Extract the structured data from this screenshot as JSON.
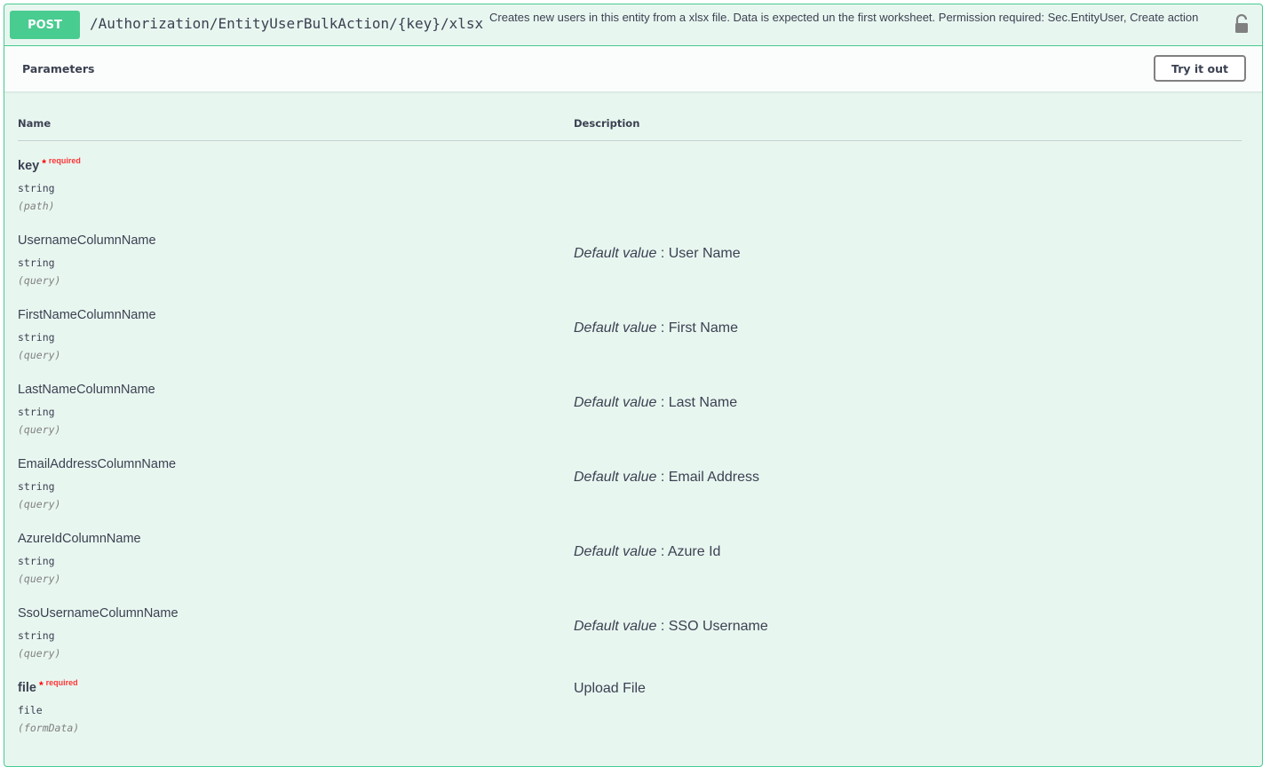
{
  "operation": {
    "method": "POST",
    "path": "/Authorization/EntityUserBulkAction/{key}/xlsx",
    "summary": "Creates new users in this entity from a xlsx file. Data is expected un the first worksheet. Permission required: Sec.EntityUser, Create action",
    "lock_icon": "unlocked-padlock-icon",
    "accent_color": "#49cc90",
    "background_color": "#e8f6f0"
  },
  "parameters_section": {
    "title": "Parameters",
    "try_button": "Try it out",
    "columns": {
      "name": "Name",
      "description": "Description"
    }
  },
  "labels": {
    "required": "required",
    "star": "*",
    "default_value": "Default value",
    "colon": " : "
  },
  "params": [
    {
      "name": "key",
      "type": "string",
      "in": "(path)",
      "default": ""
    },
    {
      "name": "UsernameColumnName",
      "type": "string",
      "in": "(query)",
      "default": "User Name"
    },
    {
      "name": "FirstNameColumnName",
      "type": "string",
      "in": "(query)",
      "default": "First Name"
    },
    {
      "name": "LastNameColumnName",
      "type": "string",
      "in": "(query)",
      "default": "Last Name"
    },
    {
      "name": "EmailAddressColumnName",
      "type": "string",
      "in": "(query)",
      "default": "Email Address"
    },
    {
      "name": "AzureIdColumnName",
      "type": "string",
      "in": "(query)",
      "default": "Azure Id"
    },
    {
      "name": "SsoUsernameColumnName",
      "type": "string",
      "in": "(query)",
      "default": "SSO Username"
    },
    {
      "name": "file",
      "type": "file",
      "in": "(formData)",
      "description": "Upload File"
    }
  ]
}
